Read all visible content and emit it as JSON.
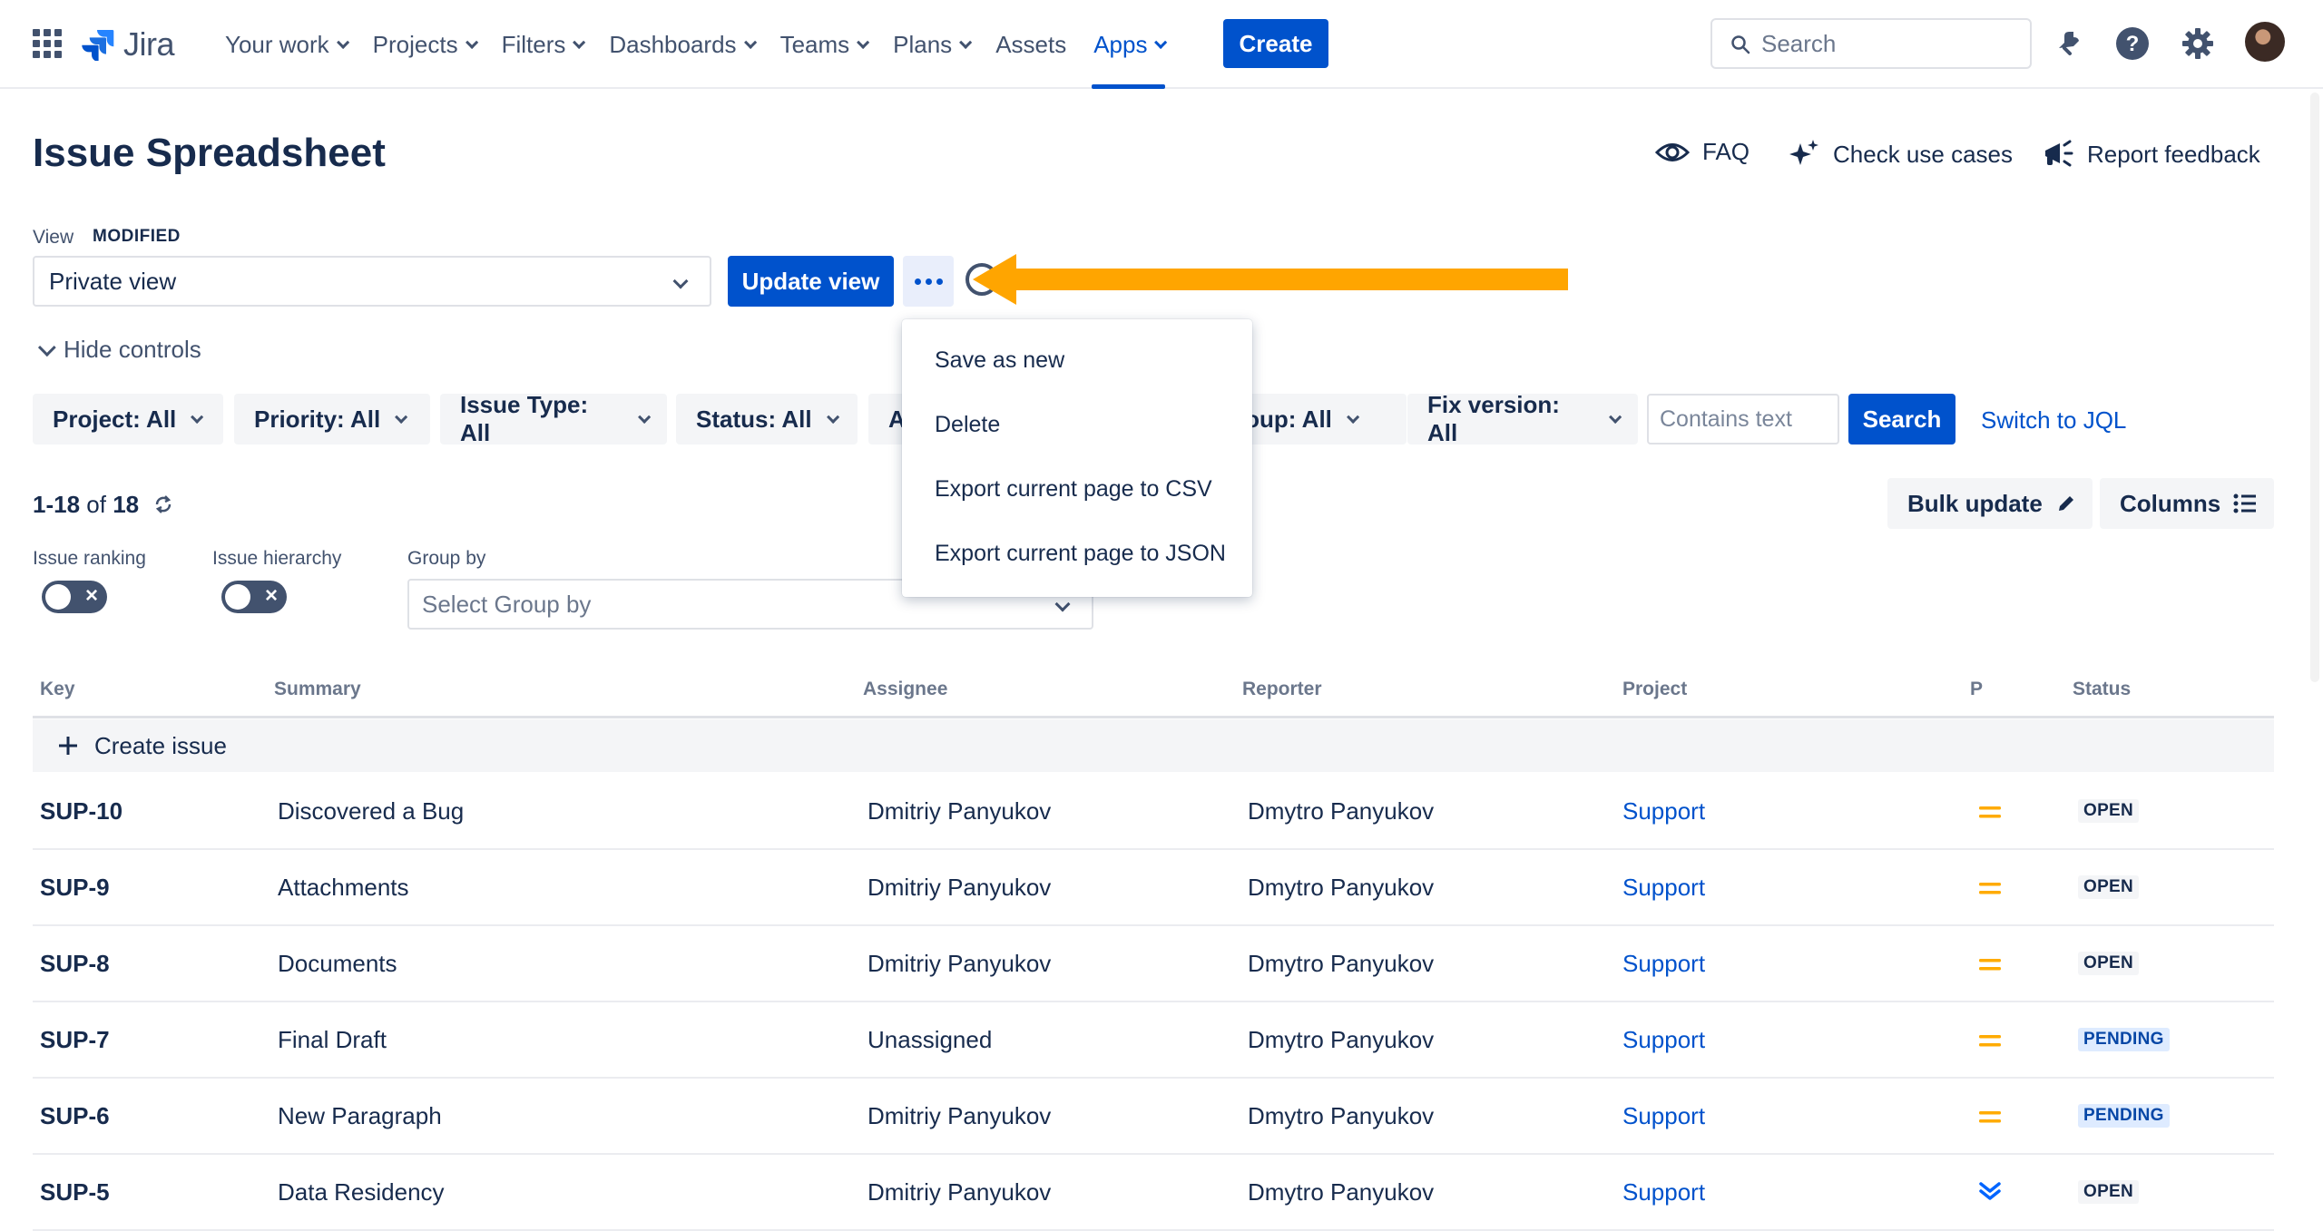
{
  "app": {
    "name": "Jira"
  },
  "nav": {
    "items": [
      {
        "label": "Your work",
        "dropdown": true
      },
      {
        "label": "Projects",
        "dropdown": true
      },
      {
        "label": "Filters",
        "dropdown": true
      },
      {
        "label": "Dashboards",
        "dropdown": true
      },
      {
        "label": "Teams",
        "dropdown": true
      },
      {
        "label": "Plans",
        "dropdown": true
      },
      {
        "label": "Assets",
        "dropdown": false
      },
      {
        "label": "Apps",
        "dropdown": true,
        "active": true
      }
    ],
    "create_label": "Create",
    "search_placeholder": "Search"
  },
  "header": {
    "title": "Issue Spreadsheet",
    "faq": "FAQ",
    "check_use_cases": "Check use cases",
    "report_feedback": "Report feedback"
  },
  "view": {
    "label": "View",
    "status": "MODIFIED",
    "selected": "Private view",
    "update_label": "Update view"
  },
  "more_menu": {
    "items": [
      "Save as new",
      "Delete",
      "Export current page to CSV",
      "Export current page to JSON"
    ]
  },
  "controls": {
    "hide_label": "Hide controls"
  },
  "filters": {
    "project": "Project: All",
    "priority": "Priority: All",
    "issue_type": "Issue Type: All",
    "status": "Status: All",
    "assignee_partial": "A",
    "group_partial": "roup: All",
    "fix_version": "Fix version: All",
    "contains_placeholder": "Contains text",
    "search_label": "Search",
    "switch_jql": "Switch to JQL"
  },
  "results": {
    "range": "1-18",
    "of": "of",
    "total": "18"
  },
  "actions": {
    "bulk_update": "Bulk update",
    "columns": "Columns"
  },
  "options": {
    "issue_ranking": "Issue ranking",
    "issue_hierarchy": "Issue hierarchy",
    "group_by_label": "Group by",
    "group_by_placeholder": "Select Group by"
  },
  "table": {
    "headers": {
      "key": "Key",
      "summary": "Summary",
      "assignee": "Assignee",
      "reporter": "Reporter",
      "project": "Project",
      "priority": "P",
      "status": "Status"
    },
    "create_issue": "Create issue",
    "rows": [
      {
        "key": "SUP-10",
        "summary": "Discovered a Bug",
        "assignee": "Dmitriy Panyukov",
        "reporter": "Dmytro Panyukov",
        "project": "Support",
        "priority": "medium",
        "status": "OPEN"
      },
      {
        "key": "SUP-9",
        "summary": "Attachments",
        "assignee": "Dmitriy Panyukov",
        "reporter": "Dmytro Panyukov",
        "project": "Support",
        "priority": "medium",
        "status": "OPEN"
      },
      {
        "key": "SUP-8",
        "summary": "Documents",
        "assignee": "Dmitriy Panyukov",
        "reporter": "Dmytro Panyukov",
        "project": "Support",
        "priority": "medium",
        "status": "OPEN"
      },
      {
        "key": "SUP-7",
        "summary": "Final Draft",
        "assignee": "Unassigned",
        "reporter": "Dmytro Panyukov",
        "project": "Support",
        "priority": "medium",
        "status": "PENDING"
      },
      {
        "key": "SUP-6",
        "summary": "New Paragraph",
        "assignee": "Dmitriy Panyukov",
        "reporter": "Dmytro Panyukov",
        "project": "Support",
        "priority": "medium",
        "status": "PENDING"
      },
      {
        "key": "SUP-5",
        "summary": "Data Residency",
        "assignee": "Dmitriy Panyukov",
        "reporter": "Dmytro Panyukov",
        "project": "Support",
        "priority": "lowest",
        "status": "OPEN"
      }
    ]
  },
  "colors": {
    "brand": "#0052CC",
    "medium_priority": "#FFAB00",
    "low_priority": "#0065FF",
    "arrow": "#FFA500",
    "pending_text": "#0747A6",
    "pending_bg": "#DEEBFF",
    "open_bg": "#F4F5F7"
  }
}
